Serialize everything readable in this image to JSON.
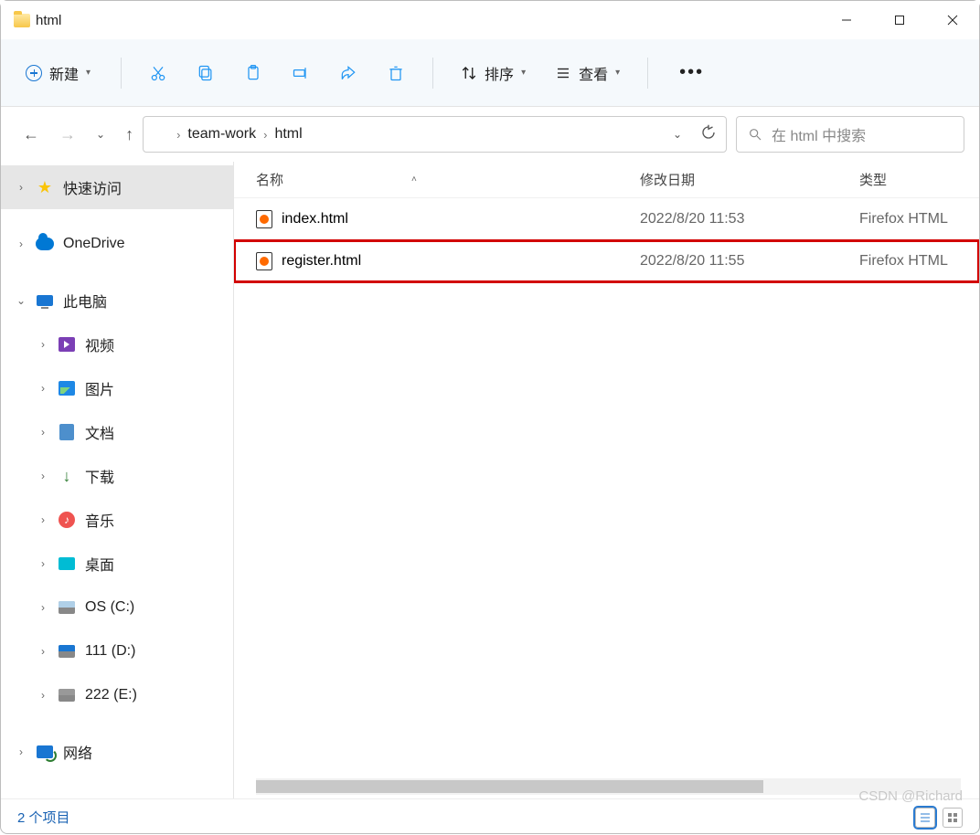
{
  "window": {
    "title": "html"
  },
  "toolbar": {
    "new_label": "新建",
    "sort_label": "排序",
    "view_label": "查看"
  },
  "breadcrumb": {
    "items": [
      "team-work",
      "html"
    ]
  },
  "search": {
    "placeholder": "在 html 中搜索"
  },
  "sidebar": {
    "quick": "快速访问",
    "onedrive": "OneDrive",
    "thispc": "此电脑",
    "video": "视频",
    "pictures": "图片",
    "documents": "文档",
    "downloads": "下载",
    "music": "音乐",
    "desktop": "桌面",
    "drive_c": "OS (C:)",
    "drive_d": "111 (D:)",
    "drive_e": "222 (E:)",
    "network": "网络"
  },
  "columns": {
    "name": "名称",
    "date": "修改日期",
    "type": "类型"
  },
  "files": [
    {
      "name": "index.html",
      "date": "2022/8/20 11:53",
      "type": "Firefox HTML",
      "highlight": false
    },
    {
      "name": "register.html",
      "date": "2022/8/20 11:55",
      "type": "Firefox HTML",
      "highlight": true
    }
  ],
  "status": {
    "count": "2 个项目"
  },
  "watermark": "CSDN @Richard"
}
